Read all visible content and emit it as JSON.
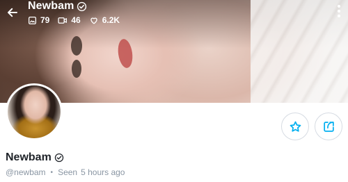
{
  "header": {
    "title": "Newbam",
    "stats": {
      "photos": "79",
      "videos": "46",
      "likes": "6.2K"
    }
  },
  "profile": {
    "name": "Newbam",
    "username": "@newbam",
    "separator": "•",
    "seen_label": "Seen",
    "seen_time": "5 hours ago"
  },
  "colors": {
    "accent": "#00aff0",
    "muted": "#8a96a3",
    "text": "#1f2329"
  },
  "icons": {
    "back": "arrow-left-icon",
    "verified": "verified-badge-icon",
    "photos": "image-icon",
    "videos": "video-icon",
    "likes": "heart-icon",
    "more": "more-vertical-icon",
    "favorite": "star-icon",
    "share": "share-icon"
  }
}
